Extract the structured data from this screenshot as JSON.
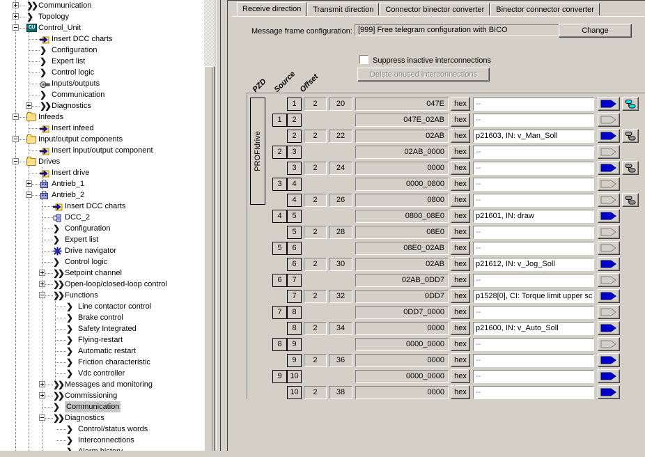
{
  "tree": {
    "items": [
      {
        "label": "Communication",
        "depth": 2,
        "icon": "chevron-double-icon",
        "toggle": "plus"
      },
      {
        "label": "Topology",
        "depth": 2,
        "icon": "chevron-icon",
        "toggle": "plus"
      },
      {
        "label": "Control_Unit",
        "depth": 2,
        "icon": "cu-icon",
        "toggle": "minus",
        "iconText": "CU"
      },
      {
        "label": "Insert DCC charts",
        "depth": 3,
        "icon": "insert-icon",
        "toggle": "none"
      },
      {
        "label": "Configuration",
        "depth": 3,
        "icon": "chevron-icon",
        "toggle": "none"
      },
      {
        "label": "Expert list",
        "depth": 3,
        "icon": "chevron-icon",
        "toggle": "none"
      },
      {
        "label": "Control logic",
        "depth": 3,
        "icon": "chevron-icon",
        "toggle": "none"
      },
      {
        "label": "Inputs/outputs",
        "depth": 3,
        "icon": "io-icon",
        "toggle": "none"
      },
      {
        "label": "Communication",
        "depth": 3,
        "icon": "chevron-icon",
        "toggle": "none"
      },
      {
        "label": "Diagnostics",
        "depth": 3,
        "icon": "chevron-double-icon",
        "toggle": "plus"
      },
      {
        "label": "Infeeds",
        "depth": 2,
        "icon": "folder-icon",
        "toggle": "minus"
      },
      {
        "label": "Insert infeed",
        "depth": 3,
        "icon": "insert-icon",
        "toggle": "none"
      },
      {
        "label": "Input/output components",
        "depth": 2,
        "icon": "folder-icon",
        "toggle": "minus"
      },
      {
        "label": "Insert input/output component",
        "depth": 3,
        "icon": "insert-icon",
        "toggle": "none"
      },
      {
        "label": "Drives",
        "depth": 2,
        "icon": "folder-icon",
        "toggle": "minus"
      },
      {
        "label": "Insert drive",
        "depth": 3,
        "icon": "insert-icon",
        "toggle": "none"
      },
      {
        "label": "Antrieb_1",
        "depth": 3,
        "icon": "drive-icon",
        "toggle": "plus"
      },
      {
        "label": "Antrieb_2",
        "depth": 3,
        "icon": "drive-icon",
        "toggle": "minus"
      },
      {
        "label": "Insert DCC charts",
        "depth": 4,
        "icon": "insert-icon",
        "toggle": "none"
      },
      {
        "label": "DCC_2",
        "depth": 4,
        "icon": "dcc-icon",
        "toggle": "none"
      },
      {
        "label": "Configuration",
        "depth": 4,
        "icon": "chevron-icon",
        "toggle": "none"
      },
      {
        "label": "Expert list",
        "depth": 4,
        "icon": "chevron-icon",
        "toggle": "none"
      },
      {
        "label": "Drive navigator",
        "depth": 4,
        "icon": "navigator-icon",
        "toggle": "none"
      },
      {
        "label": "Control logic",
        "depth": 4,
        "icon": "chevron-icon",
        "toggle": "none"
      },
      {
        "label": "Setpoint channel",
        "depth": 4,
        "icon": "chevron-double-icon",
        "toggle": "plus"
      },
      {
        "label": "Open-loop/closed-loop control",
        "depth": 4,
        "icon": "chevron-double-icon",
        "toggle": "plus"
      },
      {
        "label": "Functions",
        "depth": 4,
        "icon": "chevron-double-icon",
        "toggle": "minus"
      },
      {
        "label": "Line contactor control",
        "depth": 5,
        "icon": "chevron-icon",
        "toggle": "none"
      },
      {
        "label": "Brake control",
        "depth": 5,
        "icon": "chevron-icon",
        "toggle": "none"
      },
      {
        "label": "Safety Integrated",
        "depth": 5,
        "icon": "chevron-icon",
        "toggle": "none"
      },
      {
        "label": "Flying-restart",
        "depth": 5,
        "icon": "chevron-icon",
        "toggle": "none"
      },
      {
        "label": "Automatic restart",
        "depth": 5,
        "icon": "chevron-icon",
        "toggle": "none"
      },
      {
        "label": "Friction characteristic",
        "depth": 5,
        "icon": "chevron-icon",
        "toggle": "none"
      },
      {
        "label": "Vdc controller",
        "depth": 5,
        "icon": "chevron-icon",
        "toggle": "none"
      },
      {
        "label": "Messages and monitoring",
        "depth": 4,
        "icon": "chevron-double-icon",
        "toggle": "plus"
      },
      {
        "label": "Commissioning",
        "depth": 4,
        "icon": "chevron-double-icon",
        "toggle": "plus"
      },
      {
        "label": "Communication",
        "depth": 4,
        "icon": "chevron-icon",
        "toggle": "none",
        "selected": true
      },
      {
        "label": "Diagnostics",
        "depth": 4,
        "icon": "chevron-double-icon",
        "toggle": "minus"
      },
      {
        "label": "Control/status words",
        "depth": 5,
        "icon": "chevron-icon",
        "toggle": "none"
      },
      {
        "label": "Interconnections",
        "depth": 5,
        "icon": "chevron-icon",
        "toggle": "none"
      },
      {
        "label": "Alarm history",
        "depth": 5,
        "icon": "chevron-icon",
        "toggle": "none"
      }
    ]
  },
  "tabs": [
    {
      "label": "Receive direction",
      "active": true
    },
    {
      "label": "Transmit direction",
      "active": false
    },
    {
      "label": "Connector binector converter",
      "active": false
    },
    {
      "label": "Binector connector converter",
      "active": false
    }
  ],
  "message_frame": {
    "label": "Message frame configuration:",
    "value": "[999] Free telegram configuration with BICO",
    "change_button": "Change"
  },
  "options": {
    "suppress_label": "Suppress inactive interconnections",
    "suppress_checked": false,
    "delete_button": "Delete unused interconnections",
    "delete_enabled": false
  },
  "table": {
    "group_label": "PROFIdrive",
    "headers": [
      "PZD",
      "Source",
      "Offset"
    ],
    "hex_label": "hex",
    "empty_value": "--",
    "rows": [
      {
        "pzd_a": "",
        "pzd_b": "1",
        "wide": false,
        "source": "2",
        "offset": "20",
        "value": "047E",
        "interconnection": "--",
        "arrow": "blue",
        "conn": "cyan"
      },
      {
        "pzd_a": "1",
        "pzd_b": "2",
        "wide": true,
        "source": "",
        "offset": "",
        "value": "047E_02AB",
        "interconnection": "--",
        "arrow": "none",
        "conn": "none"
      },
      {
        "pzd_a": "",
        "pzd_b": "2",
        "wide": false,
        "source": "2",
        "offset": "22",
        "value": "02AB",
        "interconnection": "p21603, IN: v_Man_Soll",
        "arrow": "blue",
        "conn": "gray"
      },
      {
        "pzd_a": "2",
        "pzd_b": "3",
        "wide": true,
        "source": "",
        "offset": "",
        "value": "02AB_0000",
        "interconnection": "--",
        "arrow": "none",
        "conn": "none"
      },
      {
        "pzd_a": "",
        "pzd_b": "3",
        "wide": false,
        "source": "2",
        "offset": "24",
        "value": "0000",
        "interconnection": "--",
        "arrow": "blue",
        "conn": "gray"
      },
      {
        "pzd_a": "3",
        "pzd_b": "4",
        "wide": true,
        "source": "",
        "offset": "",
        "value": "0000_0800",
        "interconnection": "--",
        "arrow": "none",
        "conn": "none"
      },
      {
        "pzd_a": "",
        "pzd_b": "4",
        "wide": false,
        "source": "2",
        "offset": "26",
        "value": "0800",
        "interconnection": "--",
        "arrow": "none",
        "conn": "gray"
      },
      {
        "pzd_a": "4",
        "pzd_b": "5",
        "wide": true,
        "source": "",
        "offset": "",
        "value": "0800_08E0",
        "interconnection": "p21601, IN: draw",
        "arrow": "blue",
        "conn": "none"
      },
      {
        "pzd_a": "",
        "pzd_b": "5",
        "wide": false,
        "source": "2",
        "offset": "28",
        "value": "08E0",
        "interconnection": "--",
        "arrow": "none",
        "conn": "none"
      },
      {
        "pzd_a": "5",
        "pzd_b": "6",
        "wide": true,
        "source": "",
        "offset": "",
        "value": "08E0_02AB",
        "interconnection": "--",
        "arrow": "none",
        "conn": "none"
      },
      {
        "pzd_a": "",
        "pzd_b": "6",
        "wide": false,
        "source": "2",
        "offset": "30",
        "value": "02AB",
        "interconnection": "p21612, IN: v_Jog_Soll",
        "arrow": "blue",
        "conn": "none"
      },
      {
        "pzd_a": "6",
        "pzd_b": "7",
        "wide": true,
        "source": "",
        "offset": "",
        "value": "02AB_0DD7",
        "interconnection": "--",
        "arrow": "none",
        "conn": "none"
      },
      {
        "pzd_a": "",
        "pzd_b": "7",
        "wide": false,
        "source": "2",
        "offset": "32",
        "value": "0DD7",
        "interconnection": "p1528[0], CI: Torque limit upper sc",
        "arrow": "blue",
        "conn": "none"
      },
      {
        "pzd_a": "7",
        "pzd_b": "8",
        "wide": true,
        "source": "",
        "offset": "",
        "value": "0DD7_0000",
        "interconnection": "--",
        "arrow": "none",
        "conn": "none"
      },
      {
        "pzd_a": "",
        "pzd_b": "8",
        "wide": false,
        "source": "2",
        "offset": "34",
        "value": "0000",
        "interconnection": "p21600, IN: v_Auto_Soll",
        "arrow": "blue",
        "conn": "none"
      },
      {
        "pzd_a": "8",
        "pzd_b": "9",
        "wide": true,
        "source": "",
        "offset": "",
        "value": "0000_0000",
        "interconnection": "--",
        "arrow": "none",
        "conn": "none"
      },
      {
        "pzd_a": "",
        "pzd_b": "9",
        "wide": false,
        "source": "2",
        "offset": "36",
        "value": "0000",
        "interconnection": "--",
        "arrow": "blue",
        "conn": "none"
      },
      {
        "pzd_a": "9",
        "pzd_b": "10",
        "wide": true,
        "source": "",
        "offset": "",
        "value": "0000_0000",
        "interconnection": "--",
        "arrow": "blue",
        "conn": "none"
      },
      {
        "pzd_a": "",
        "pzd_b": "10",
        "wide": false,
        "source": "2",
        "offset": "38",
        "value": "0000",
        "interconnection": "--",
        "arrow": "blue",
        "conn": "none"
      }
    ]
  },
  "colors": {
    "face": "#d4d0c8",
    "accent_blue": "#0000cc",
    "accent_cyan": "#00ffff",
    "selection": "#c8c8c8"
  }
}
